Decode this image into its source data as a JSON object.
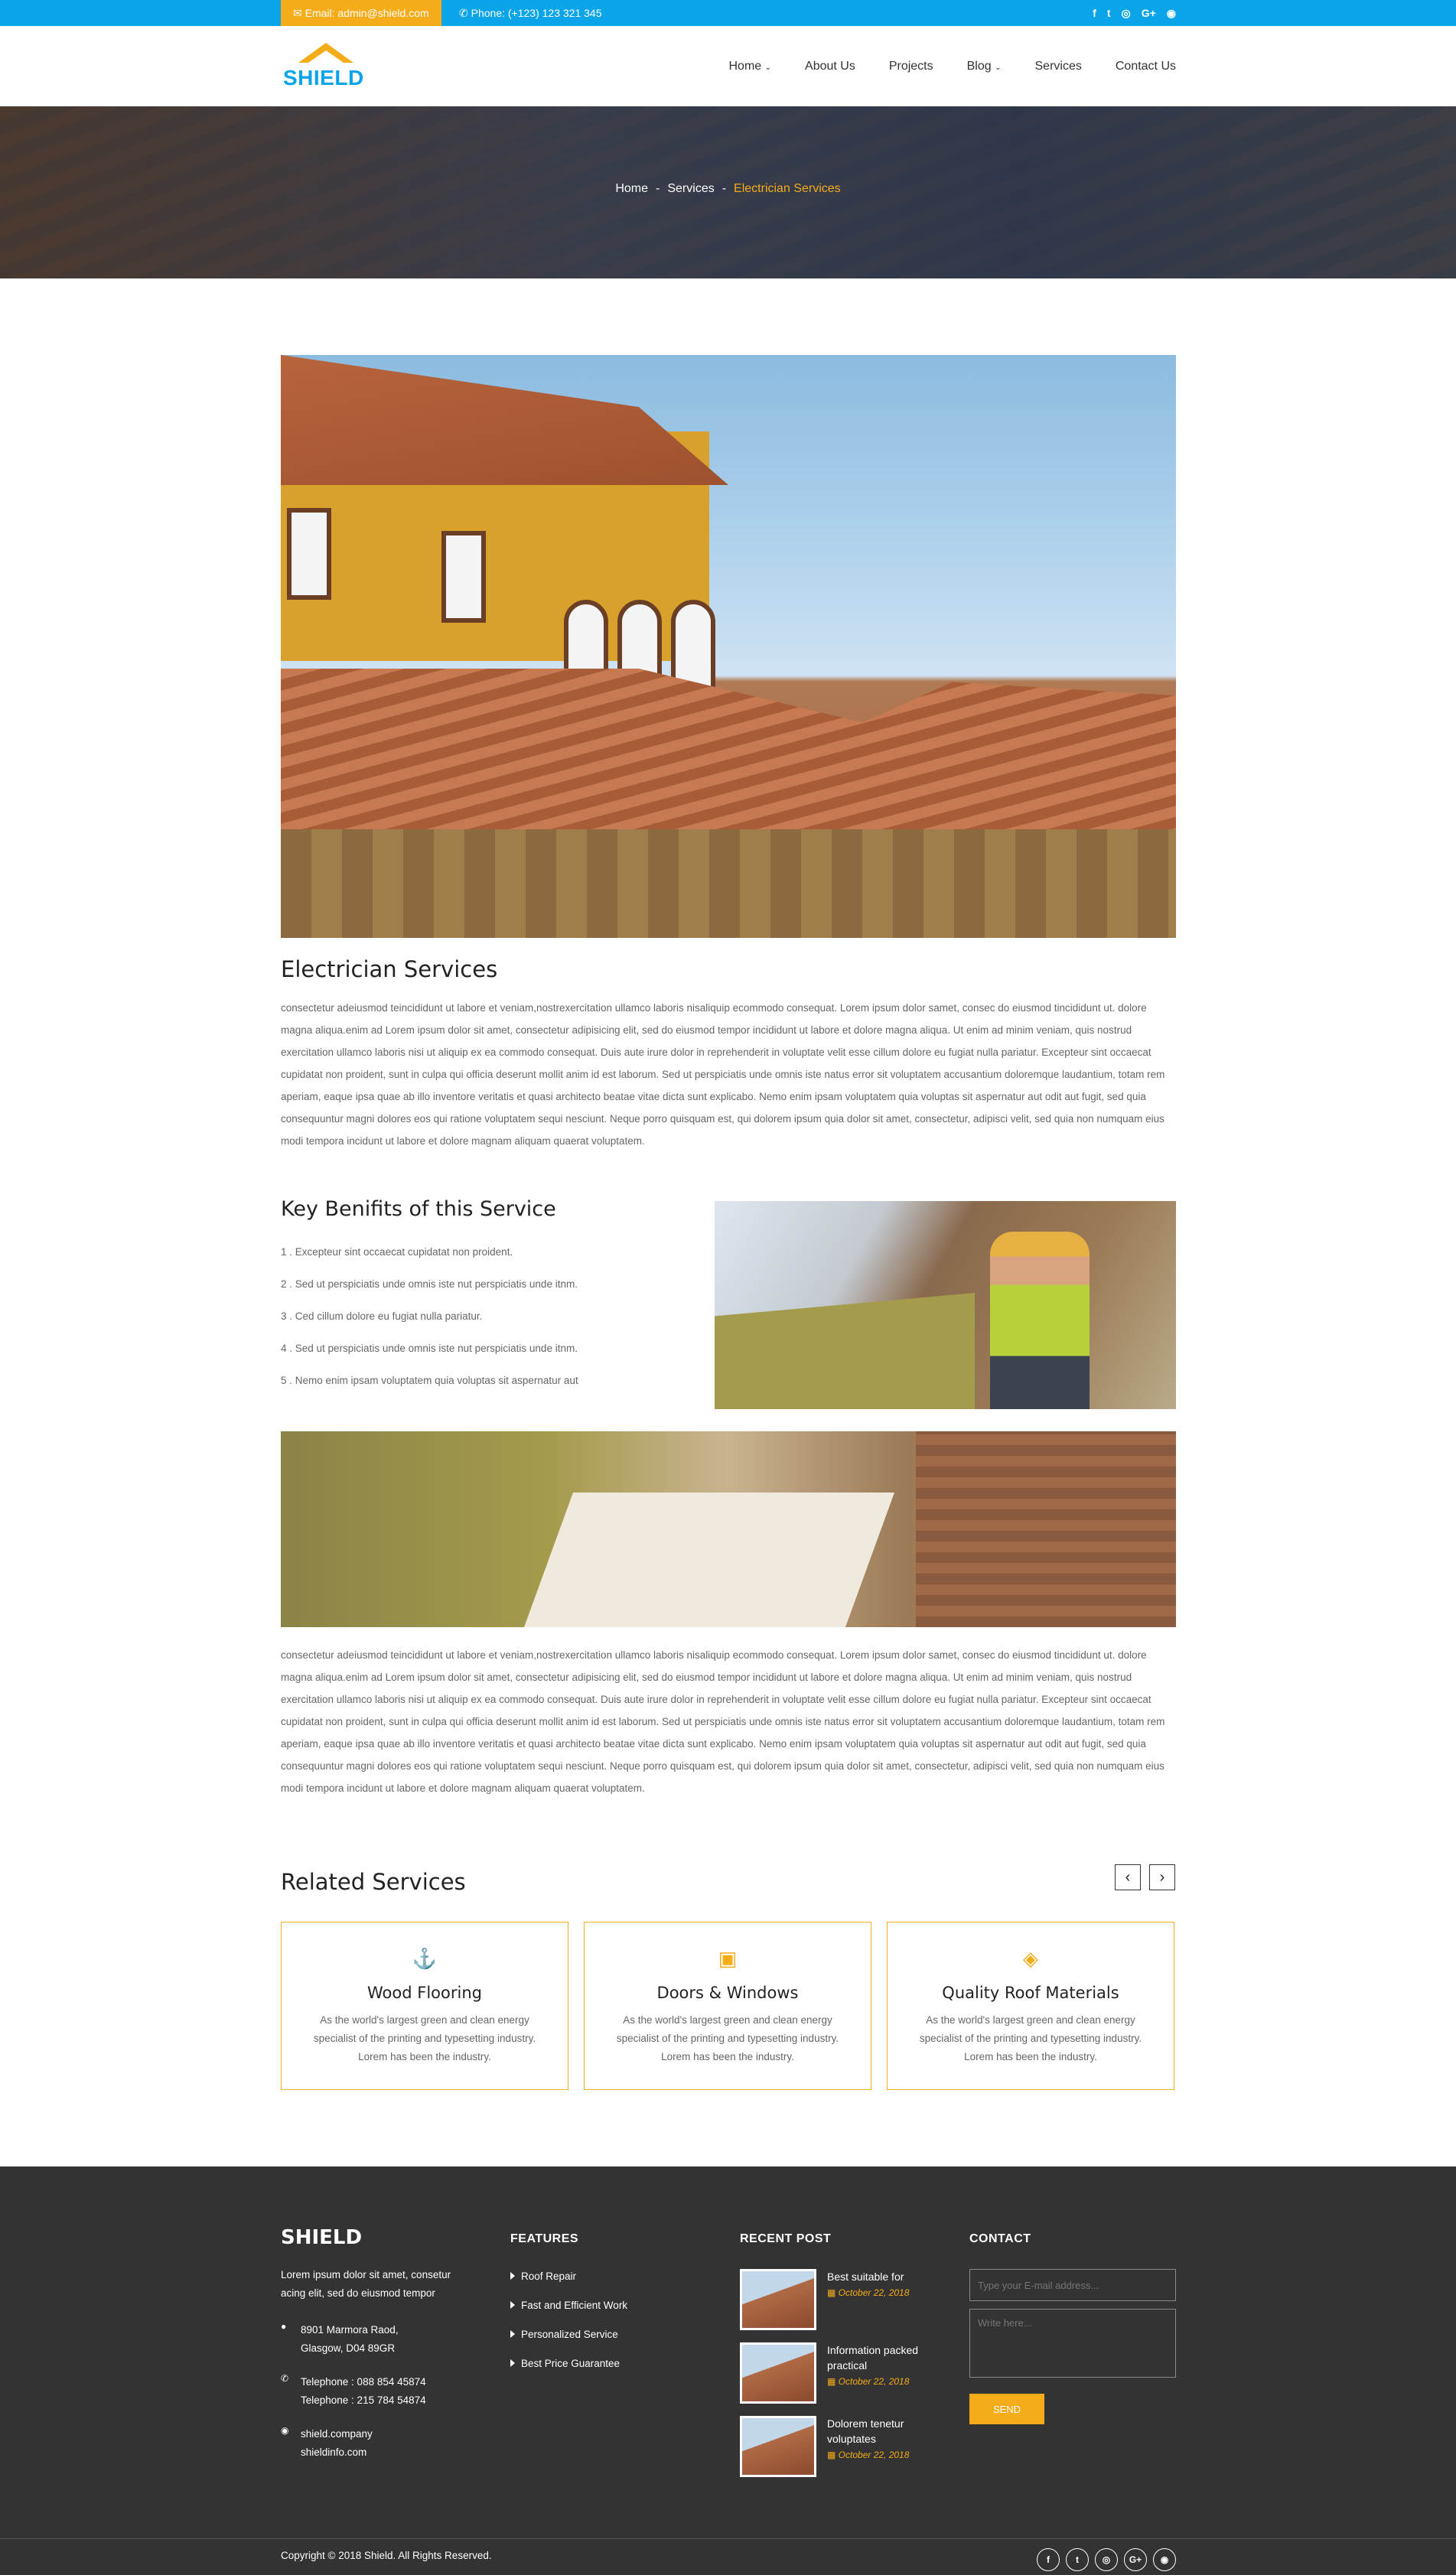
{
  "topbar": {
    "email": "Email: admin@shield.com",
    "phone": "Phone: (+123) 123 321 345",
    "social": [
      "f",
      "t",
      "◎",
      "G+",
      "◉"
    ]
  },
  "logo": {
    "text": "SHIELD"
  },
  "nav": [
    "Home",
    "About Us",
    "Projects",
    "Blog",
    "Services",
    "Contact Us"
  ],
  "breadcrumb": {
    "home": "Home",
    "services": "Services",
    "current": "Electrician Services",
    "sep": "-"
  },
  "main": {
    "title": "Electrician Services",
    "paragraph": "consectetur adeiusmod teincididunt ut labore et veniam,nostrexercitation ullamco laboris nisaliquip ecommodo consequat. Lorem ipsum dolor samet, consec do eiusmod tincididunt ut. dolore magna aliqua.enim ad Lorem ipsum dolor sit amet, consectetur adipisicing elit, sed do eiusmod tempor incididunt ut labore et dolore magna aliqua. Ut enim ad minim veniam, quis nostrud exercitation ullamco laboris nisi ut aliquip ex ea commodo consequat. Duis aute irure dolor in reprehenderit in voluptate velit esse cillum dolore eu fugiat nulla pariatur. Excepteur sint occaecat cupidatat non proident, sunt in culpa qui officia deserunt mollit anim id est laborum. Sed ut perspiciatis unde omnis iste natus error sit voluptatem accusantium doloremque laudantium, totam rem aperiam, eaque ipsa quae ab illo inventore veritatis et quasi architecto beatae vitae dicta sunt explicabo. Nemo enim ipsam voluptatem quia voluptas sit aspernatur aut odit aut fugit, sed quia consequuntur magni dolores eos qui ratione voluptatem sequi nesciunt. Neque porro quisquam est, qui dolorem ipsum quia dolor sit amet, consectetur, adipisci velit, sed quia non numquam eius modi tempora incidunt ut labore et dolore magnam aliquam quaerat voluptatem.",
    "benefits_title": "Key Benifits of this Service",
    "benefits": [
      "1 . Excepteur sint occaecat cupidatat non proident.",
      "2 . Sed ut perspiciatis unde omnis iste nut perspiciatis unde itnm.",
      "3 . Ced cillum dolore eu fugiat nulla pariatur.",
      "4 . Sed ut perspiciatis unde omnis iste nut perspiciatis unde itnm.",
      "5 . Nemo enim ipsam voluptatem quia voluptas sit aspernatur aut"
    ],
    "paragraph2": "consectetur adeiusmod teincididunt ut labore et veniam,nostrexercitation ullamco laboris nisaliquip ecommodo consequat. Lorem ipsum dolor samet, consec do eiusmod tincididunt ut. dolore magna aliqua.enim ad Lorem ipsum dolor sit amet, consectetur adipisicing elit, sed do eiusmod tempor incididunt ut labore et dolore magna aliqua. Ut enim ad minim veniam, quis nostrud exercitation ullamco laboris nisi ut aliquip ex ea commodo consequat. Duis aute irure dolor in reprehenderit in voluptate velit esse cillum dolore eu fugiat nulla pariatur. Excepteur sint occaecat cupidatat non proident, sunt in culpa qui officia deserunt mollit anim id est laborum. Sed ut perspiciatis unde omnis iste natus error sit voluptatem accusantium doloremque laudantium, totam rem aperiam, eaque ipsa quae ab illo inventore veritatis et quasi architecto beatae vitae dicta sunt explicabo. Nemo enim ipsam voluptatem quia voluptas sit aspernatur aut odit aut fugit, sed quia consequuntur magni dolores eos qui ratione voluptatem sequi nesciunt. Neque porro quisquam est, qui dolorem ipsum quia dolor sit amet, consectetur, adipisci velit, sed quia non numquam eius modi tempora incidunt ut labore et dolore magnam aliquam quaerat voluptatem."
  },
  "related": {
    "title": "Related Services",
    "prev": "‹",
    "next": "›",
    "cards": [
      {
        "icon": "⚓",
        "title": "Wood Flooring",
        "text": "As the world's largest green and clean energy specialist of the printing and typesetting industry. Lorem has been the industry."
      },
      {
        "icon": "▣",
        "title": "Doors & Windows",
        "text": "As the world's largest green and clean energy specialist of the printing and typesetting industry. Lorem has been the industry."
      },
      {
        "icon": "◈",
        "title": "Quality Roof Materials",
        "text": "As the world's largest green and clean energy specialist of the printing and typesetting industry. Lorem has been the industry."
      }
    ]
  },
  "footer": {
    "logo": "SHIELD",
    "about": "Lorem ipsum dolor sit amet, consetur acing elit, sed do eiusmod tempor",
    "address": [
      "8901 Marmora Raod,",
      "Glasgow, D04 89GR"
    ],
    "phones": [
      "Telephone : 088 854 45874",
      "Telephone : 215 784 54874"
    ],
    "sites": [
      "shield.company",
      "shieldinfo.com"
    ],
    "features_title": "FEATURES",
    "features": [
      "Roof Repair",
      "Fast and Efficient Work",
      "Personalized Service",
      "Best Price Guarantee"
    ],
    "recent_title": "RECENT POST",
    "posts": [
      {
        "title": "Best suitable for",
        "date": "October 22, 2018"
      },
      {
        "title": "Information packed practical",
        "date": "October 22, 2018"
      },
      {
        "title": "Dolorem tenetur voluptates",
        "date": "October 22, 2018"
      }
    ],
    "contact_title": "CONTACT",
    "email_placeholder": "Type your E-mail address...",
    "message_placeholder": "Write here...",
    "send": "SEND",
    "copyright": "Copyright © 2018 Shield. All Rights Reserved.",
    "social": [
      "f",
      "t",
      "◎",
      "G+",
      "◉"
    ]
  },
  "colors": {
    "accent": "#f5ac19",
    "topbar": "#0aa4e8",
    "footer": "#333333"
  }
}
